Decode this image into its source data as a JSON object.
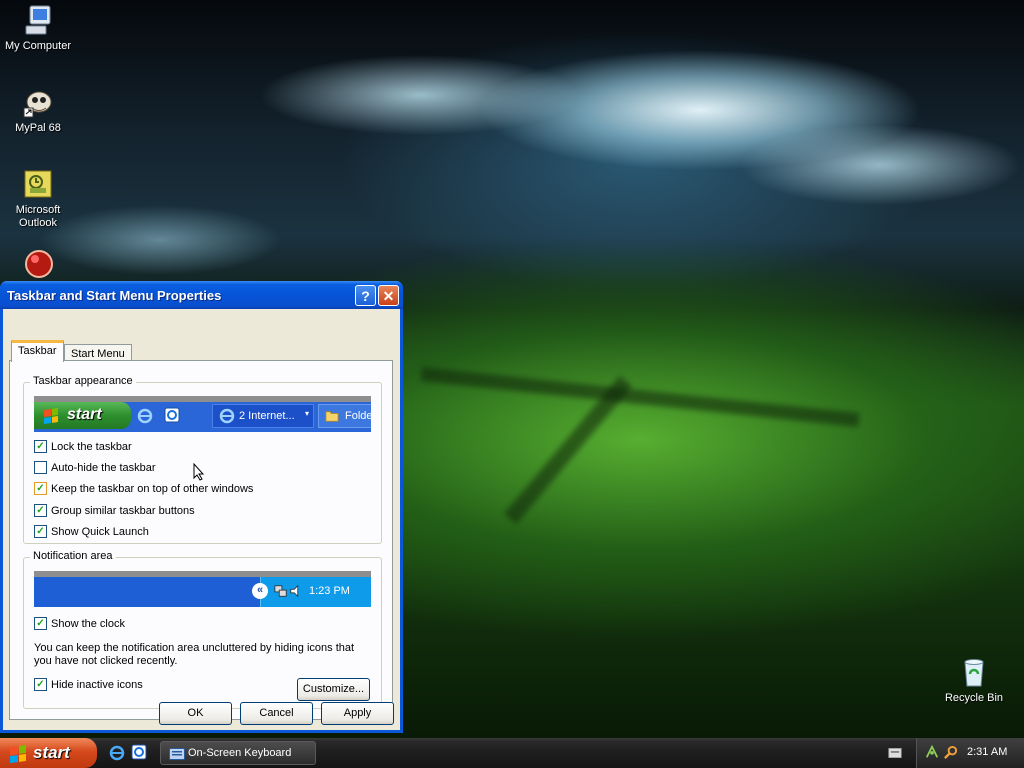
{
  "desktop": {
    "icons": [
      {
        "label": "My Computer"
      },
      {
        "label": "MyPal 68"
      },
      {
        "label": "Microsoft Outlook"
      },
      {
        "label": "Recycle Bin"
      }
    ]
  },
  "dialog": {
    "title": "Taskbar and Start Menu Properties",
    "help_glyph": "?",
    "close_glyph": "✕",
    "tabs": [
      "Taskbar",
      "Start Menu"
    ],
    "active_tab": "Taskbar",
    "appearance": {
      "group_label": "Taskbar appearance",
      "preview": {
        "start_label": "start",
        "task_label": "2 Internet...",
        "folder_label": "Folde"
      },
      "checkboxes": [
        {
          "label": "Lock the taskbar",
          "checked": true
        },
        {
          "label": "Auto-hide the taskbar",
          "checked": false
        },
        {
          "label": "Keep the taskbar on top of other windows",
          "checked": true
        },
        {
          "label": "Group similar taskbar buttons",
          "checked": true
        },
        {
          "label": "Show Quick Launch",
          "checked": true
        }
      ]
    },
    "notification": {
      "group_label": "Notification area",
      "preview_clock": "1:23 PM",
      "show_clock": {
        "label": "Show the clock",
        "checked": true
      },
      "description": "You can keep the notification area uncluttered by hiding icons that you have not clicked recently.",
      "hide_inactive": {
        "label": "Hide inactive icons",
        "checked": true
      },
      "customize_label": "Customize..."
    },
    "buttons": {
      "ok": "OK",
      "cancel": "Cancel",
      "apply": "Apply"
    }
  },
  "taskbar": {
    "start_label": "start",
    "task_label": "On-Screen Keyboard",
    "clock": "2:31 AM"
  },
  "colors": {
    "xp_blue": "#0a58d8",
    "start_orange": "#d5491d",
    "dialog_bg": "#ece9d8",
    "taskbar_dark": "#1e1e1e"
  }
}
